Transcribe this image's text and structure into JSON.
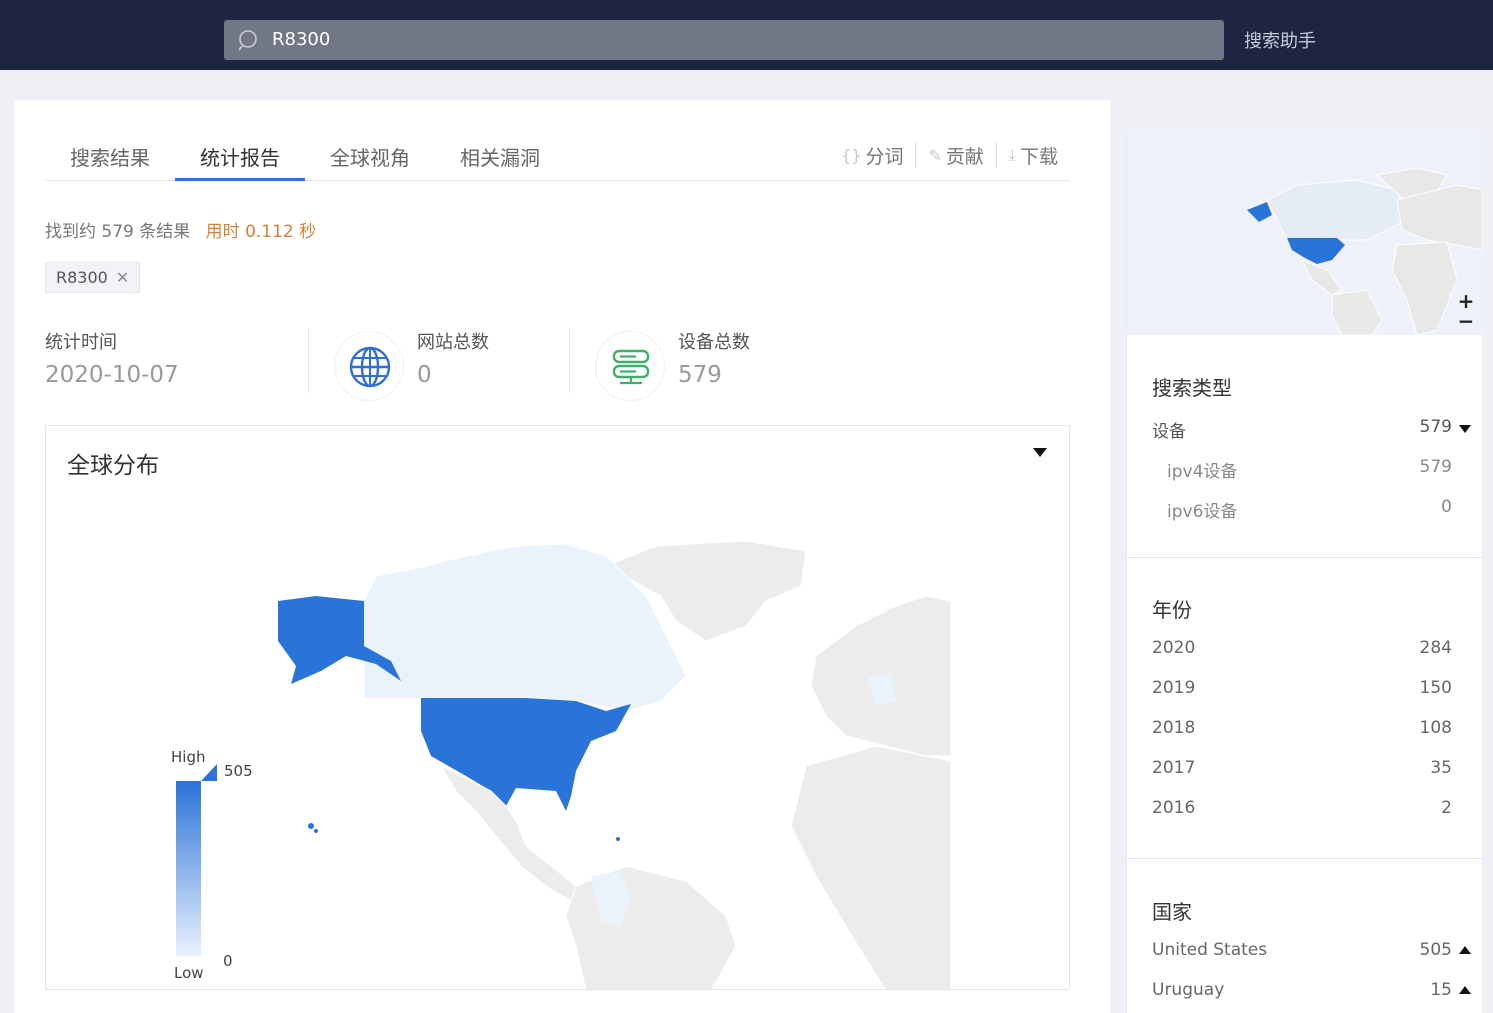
{
  "search": {
    "value": "R8300",
    "helper": "搜索助手"
  },
  "tabs": [
    {
      "label": "搜索结果"
    },
    {
      "label": "统计报告",
      "active": true
    },
    {
      "label": "全球视角"
    },
    {
      "label": "相关漏洞"
    }
  ],
  "tools": [
    {
      "label": "分词",
      "icon": "braces-icon"
    },
    {
      "label": "贡献",
      "icon": "edit-icon"
    },
    {
      "label": "下载",
      "icon": "download-icon"
    }
  ],
  "result": {
    "summary": "找到约 579 条结果",
    "time": "用时 0.112 秒"
  },
  "tag": {
    "label": "R8300"
  },
  "stats": {
    "time": {
      "label": "统计时间",
      "value": "2020-10-07"
    },
    "sites": {
      "label": "网站总数",
      "value": "0"
    },
    "devices": {
      "label": "设备总数",
      "value": "579"
    }
  },
  "map": {
    "title": "全球分布",
    "legend_high": "High",
    "legend_low": "Low",
    "legend_max": "505",
    "legend_min": "0",
    "colors": {
      "high": "#2a73d8",
      "low": "#eaf2fc",
      "none": "#ececec"
    }
  },
  "side": {
    "zoom_in": "+",
    "zoom_out": "−",
    "search_type": {
      "title": "搜索类型",
      "main": {
        "label": "设备",
        "count": "579"
      },
      "subs": [
        {
          "label": "ipv4设备",
          "count": "579"
        },
        {
          "label": "ipv6设备",
          "count": "0"
        }
      ]
    },
    "year": {
      "title": "年份",
      "items": [
        {
          "label": "2020",
          "count": "284"
        },
        {
          "label": "2019",
          "count": "150"
        },
        {
          "label": "2018",
          "count": "108"
        },
        {
          "label": "2017",
          "count": "35"
        },
        {
          "label": "2016",
          "count": "2"
        }
      ]
    },
    "country": {
      "title": "国家",
      "items": [
        {
          "label": "United States",
          "count": "505"
        },
        {
          "label": "Uruguay",
          "count": "15"
        }
      ]
    }
  }
}
